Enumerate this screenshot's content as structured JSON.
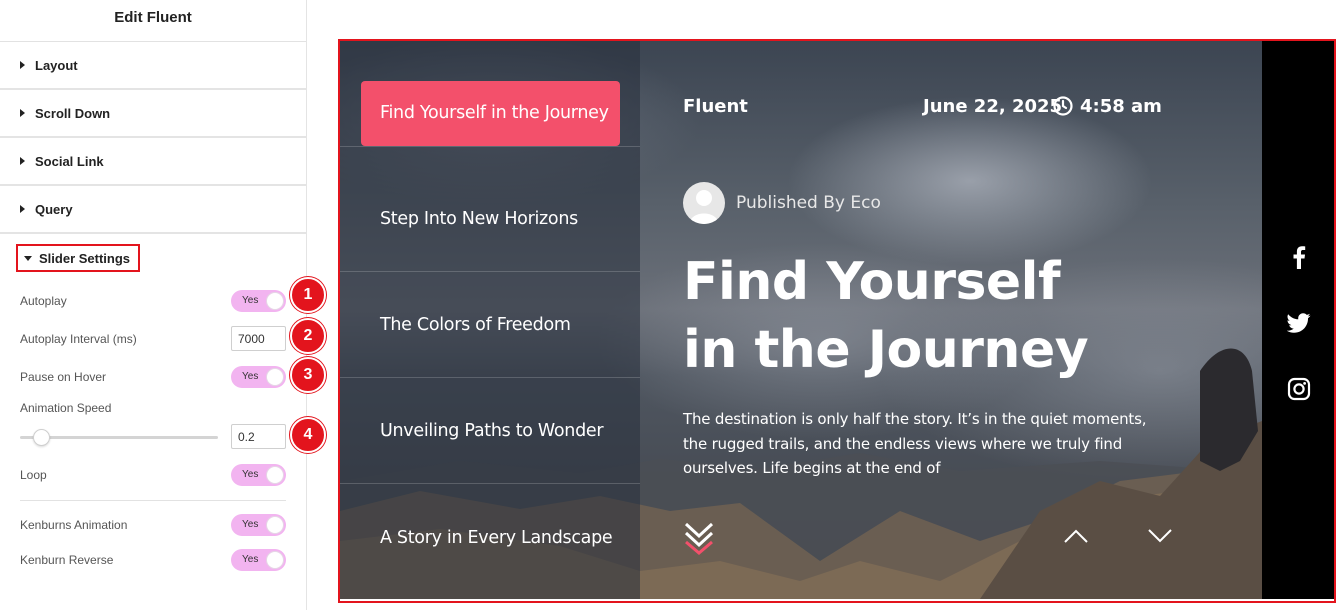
{
  "panel": {
    "title": "Edit Fluent",
    "sections": [
      {
        "label": "Layout"
      },
      {
        "label": "Scroll Down"
      },
      {
        "label": "Social Link"
      },
      {
        "label": "Query"
      }
    ],
    "slider_settings": {
      "label": "Slider Settings",
      "autoplay": {
        "label": "Autoplay",
        "value": "Yes"
      },
      "autoplay_interval": {
        "label": "Autoplay Interval (ms)",
        "value": "7000"
      },
      "pause_on_hover": {
        "label": "Pause on Hover",
        "value": "Yes"
      },
      "animation_speed": {
        "label": "Animation Speed",
        "value": "0.2"
      },
      "loop": {
        "label": "Loop",
        "value": "Yes"
      },
      "kenburns_animation": {
        "label": "Kenburns Animation",
        "value": "Yes"
      },
      "kenburn_reverse": {
        "label": "Kenburn Reverse",
        "value": "Yes"
      }
    },
    "badges": [
      "1",
      "2",
      "3",
      "4"
    ]
  },
  "preview": {
    "menu": [
      {
        "label": "Find Yourself in the Journey",
        "active": true
      },
      {
        "label": "Step Into New Horizons"
      },
      {
        "label": "The Colors of Freedom"
      },
      {
        "label": "Unveiling Paths to Wonder"
      },
      {
        "label": "A Story in Every Landscape"
      }
    ],
    "brand": "Fluent",
    "date": "June 22, 2025",
    "time": "4:58 am",
    "author": "Published By Eco",
    "headline": "Find Yourself in the Journey",
    "excerpt": "The destination is only half the story. It’s in the quiet moments, the rugged trails, and the endless views where we truly find ourselves. Life begins at the end of",
    "social_icons": [
      "facebook-icon",
      "twitter-icon",
      "instagram-icon"
    ]
  },
  "colors": {
    "accent": "#f3506b",
    "annotation_red": "#e3141d",
    "toggle_on": "#f2b4f0"
  }
}
